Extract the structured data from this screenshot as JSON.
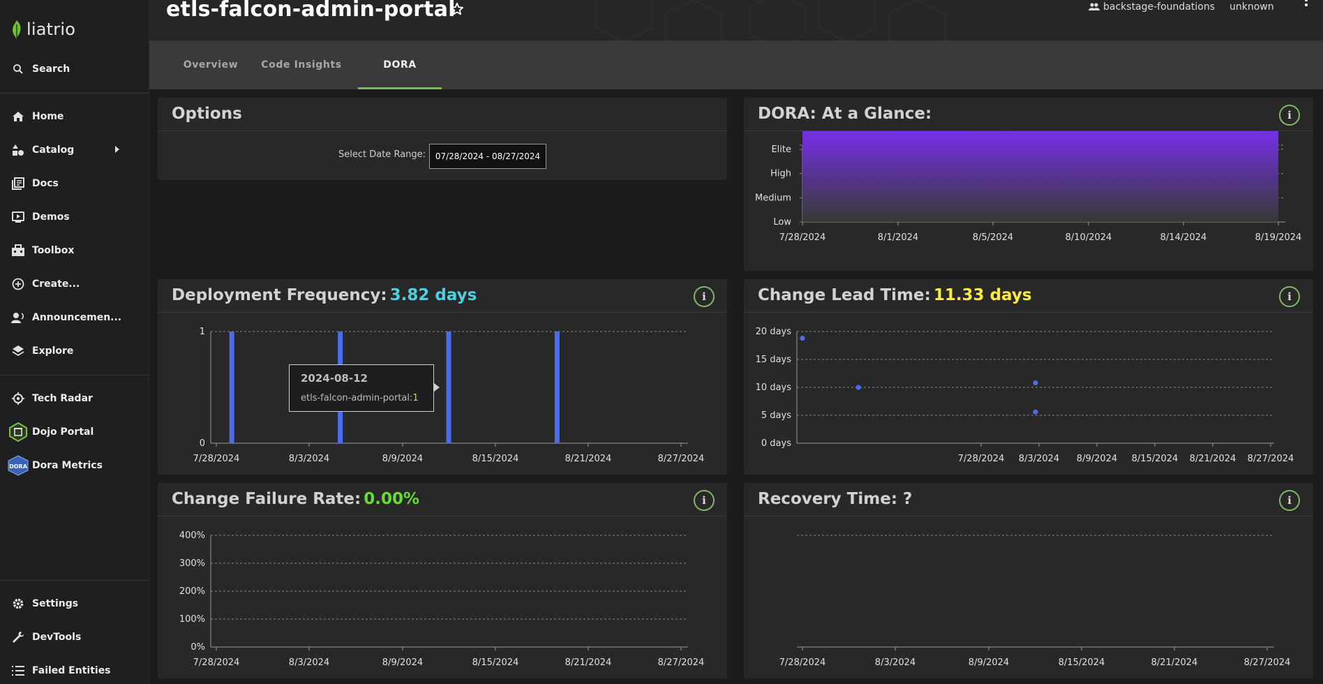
{
  "app": {
    "logo_text": "liatrio"
  },
  "sidebar": {
    "search_label": "Search",
    "items": [
      {
        "label": "Home"
      },
      {
        "label": "Catalog"
      },
      {
        "label": "Docs"
      },
      {
        "label": "Demos"
      },
      {
        "label": "Toolbox"
      },
      {
        "label": "Create..."
      },
      {
        "label": "Announcemen..."
      },
      {
        "label": "Explore"
      }
    ],
    "plugins": [
      {
        "label": "Tech Radar"
      },
      {
        "label": "Dojo Portal"
      },
      {
        "label": "Dora Metrics",
        "icon_text": "DORA"
      }
    ],
    "bottom": [
      {
        "label": "Settings"
      },
      {
        "label": "DevTools"
      },
      {
        "label": "Failed Entities"
      }
    ]
  },
  "header": {
    "title": "etls-falcon-admin-portal",
    "owner": "backstage-foundations",
    "lifecycle": "unknown"
  },
  "tabs": [
    {
      "label": "Overview"
    },
    {
      "label": "Code Insights"
    },
    {
      "label": "DORA",
      "active": true
    }
  ],
  "options": {
    "title": "Options",
    "date_range_label": "Select Date Range:",
    "date_range_value": "07/28/2024 - 08/27/2024"
  },
  "glance": {
    "title": "DORA: At a Glance:"
  },
  "deployment": {
    "title": "Deployment Frequency:",
    "value": "3.82 days",
    "value_color": "#4dd0e1"
  },
  "lead_time": {
    "title": "Change Lead Time:",
    "value": "11.33 days",
    "value_color": "#ffeb3b"
  },
  "failure_rate": {
    "title": "Change Failure Rate:",
    "value": "0.00%",
    "value_color": "#66dd33"
  },
  "recovery": {
    "title": "Recovery Time: ?"
  },
  "tooltip": {
    "date": "2024-08-12",
    "series": "etls-falcon-admin-portal:",
    "value": "1"
  },
  "chart_data": [
    {
      "id": "glance",
      "type": "area",
      "x": [
        "7/28/2024",
        "8/1/2024",
        "8/5/2024",
        "8/10/2024",
        "8/14/2024",
        "8/19/2024"
      ],
      "y_categories": [
        "Low",
        "Medium",
        "High",
        "Elite"
      ],
      "values": [
        3.75,
        3.75,
        3.75,
        3.98,
        3.95,
        3.75
      ],
      "color": "#7b2ff7",
      "grid": true
    },
    {
      "id": "deployment",
      "type": "bar",
      "x_ticks": [
        "7/28/2024",
        "8/3/2024",
        "8/9/2024",
        "8/15/2024",
        "8/21/2024",
        "8/27/2024"
      ],
      "y_ticks": [
        "0",
        "1"
      ],
      "bars": [
        {
          "date": "2024-07-29",
          "value": 1
        },
        {
          "date": "2024-08-05",
          "value": 1
        },
        {
          "date": "2024-08-12",
          "value": 1
        },
        {
          "date": "2024-08-19",
          "value": 1
        }
      ],
      "color": "#4a6cf0",
      "grid": true
    },
    {
      "id": "lead_time",
      "type": "scatter",
      "x_ticks": [
        "7/28/2024",
        "8/3/2024",
        "8/9/2024",
        "8/15/2024",
        "8/21/2024",
        "8/27/2024"
      ],
      "y_ticks": [
        "0 days",
        "5 days",
        "10 days",
        "15 days",
        "20 days"
      ],
      "ylim": [
        0,
        20
      ],
      "points": [
        {
          "x": 0,
          "y": 18.8
        },
        {
          "x": 0.12,
          "y": 10
        },
        {
          "x": 0.5,
          "y": 10.8
        },
        {
          "x": 0.5,
          "y": 5.6
        }
      ],
      "color": "#4a6cf0",
      "grid": true
    },
    {
      "id": "failure_rate",
      "type": "line",
      "x_ticks": [
        "7/28/2024",
        "8/3/2024",
        "8/9/2024",
        "8/15/2024",
        "8/21/2024",
        "8/27/2024"
      ],
      "y_ticks": [
        "0%",
        "100%",
        "200%",
        "300%",
        "400%"
      ],
      "ylim": [
        0,
        400
      ],
      "series": [],
      "grid": true
    },
    {
      "id": "recovery",
      "type": "line",
      "x_ticks": [
        "7/28/2024",
        "8/3/2024",
        "8/9/2024",
        "8/15/2024",
        "8/21/2024",
        "8/27/2024"
      ],
      "y_ticks": [],
      "series": [],
      "grid": true
    }
  ]
}
